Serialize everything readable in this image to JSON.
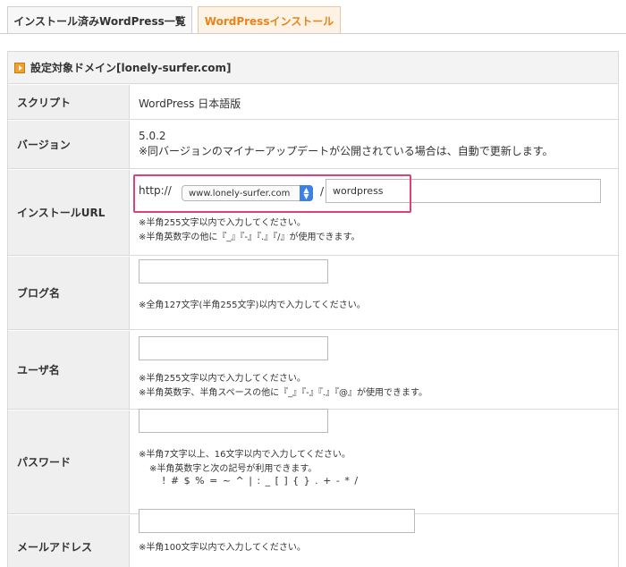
{
  "tabs": [
    {
      "label": "インストール済みWordPress一覧"
    },
    {
      "label": "WordPressインストール"
    }
  ],
  "panel": {
    "title": "設定対象ドメイン[lonely-surfer.com]"
  },
  "rows": {
    "script": {
      "label": "スクリプト",
      "value": "WordPress 日本語版"
    },
    "version": {
      "label": "バージョン",
      "value": "5.0.2",
      "note": "※同バージョンのマイナーアップデートが公開されている場合は、自動で更新します。"
    },
    "url": {
      "label": "インストールURL",
      "protocol": "http://",
      "domain_selected": "www.lonely-surfer.com",
      "separator": "/",
      "path_value": "wordpress",
      "note1": "※半角255文字以内で入力してください。",
      "note2": "※半角英数字の他に『_』『-』『.』『/』が使用できます。"
    },
    "blog": {
      "label": "ブログ名",
      "value": "",
      "note": "※全角127文字(半角255文字)以内で入力してください。"
    },
    "user": {
      "label": "ユーザ名",
      "value": "",
      "note1": "※半角255文字以内で入力してください。",
      "note2": "※半角英数字、半角スペースの他に『_』『-』『.』『@』が使用できます。"
    },
    "password": {
      "label": "パスワード",
      "value": "",
      "note1": "※半角7文字以上、16文字以内で入力してください。",
      "note2": "※半角英数字と次の記号が利用できます。",
      "symbols": "! # $ % = ~ ^ | : _ [ ] { } . + - * /"
    },
    "email": {
      "label": "メールアドレス",
      "value": "",
      "note": "※半角100文字以内で入力してください。"
    }
  },
  "colors": {
    "accent_tab_text": "#e8841a",
    "highlight_border": "#e0407a",
    "select_arrow": "#3d80e6"
  }
}
